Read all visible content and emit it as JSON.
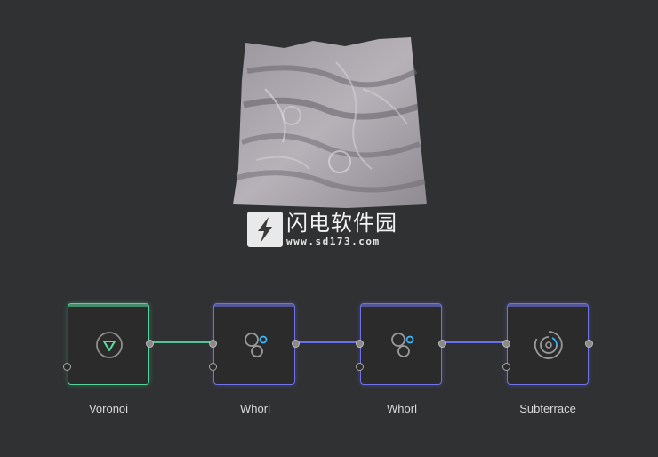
{
  "watermark": {
    "title": "闪电软件园",
    "url": "www.sd173.com"
  },
  "graph": {
    "nodes": [
      {
        "label": "Voronoi",
        "icon": "triangle-down-in-circle-icon",
        "accent": "#55d49a"
      },
      {
        "label": "Whorl",
        "icon": "whorl-circles-icon",
        "accent": "#6f73e8"
      },
      {
        "label": "Whorl",
        "icon": "whorl-circles-icon",
        "accent": "#6f73e8"
      },
      {
        "label": "Subterrace",
        "icon": "subterrace-rings-icon",
        "accent": "#6f73e8"
      }
    ],
    "wire_colors": [
      "#4fc495",
      "#6a6ef0",
      "#6a6ef0"
    ]
  }
}
